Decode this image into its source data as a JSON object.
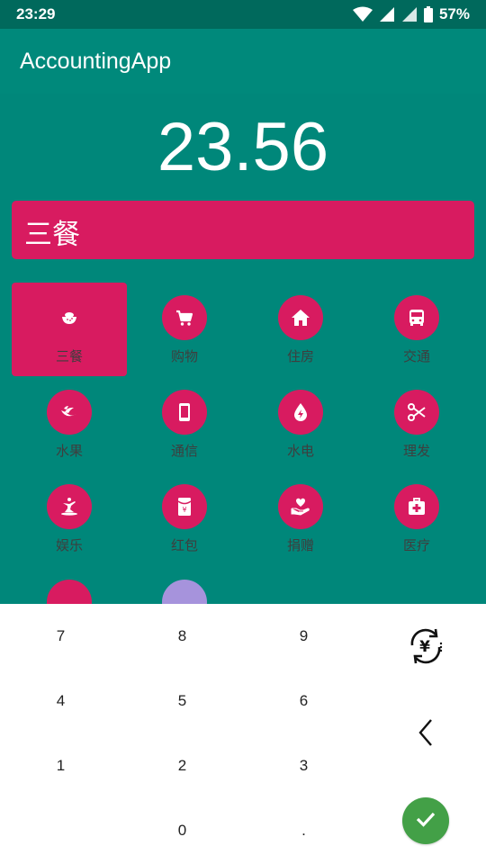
{
  "status_bar": {
    "time": "23:29",
    "battery": "57%"
  },
  "app_bar": {
    "title": "AccountingApp"
  },
  "amount": "23.56",
  "selected_category": "三餐",
  "categories": [
    {
      "label": "三餐",
      "icon": "rice-bowl-icon",
      "selected": true
    },
    {
      "label": "购物",
      "icon": "shopping-cart-icon",
      "selected": false
    },
    {
      "label": "住房",
      "icon": "home-icon",
      "selected": false
    },
    {
      "label": "交通",
      "icon": "bus-icon",
      "selected": false
    },
    {
      "label": "水果",
      "icon": "fruit-icon",
      "selected": false
    },
    {
      "label": "通信",
      "icon": "phone-icon",
      "selected": false
    },
    {
      "label": "水电",
      "icon": "water-electric-icon",
      "selected": false
    },
    {
      "label": "理发",
      "icon": "scissors-icon",
      "selected": false
    },
    {
      "label": "娱乐",
      "icon": "entertainment-icon",
      "selected": false
    },
    {
      "label": "红包",
      "icon": "red-packet-icon",
      "selected": false
    },
    {
      "label": "捐赠",
      "icon": "donation-icon",
      "selected": false
    },
    {
      "label": "医疗",
      "icon": "medical-kit-icon",
      "selected": false
    }
  ],
  "keypad": {
    "keys": [
      "7",
      "8",
      "9",
      "4",
      "5",
      "6",
      "1",
      "2",
      "3",
      "",
      "0",
      "."
    ],
    "currency_switch_icon": "currency-switch-icon",
    "backspace_icon": "backspace-chevron-icon",
    "confirm_icon": "checkmark-icon"
  },
  "colors": {
    "status_bar": "#00695c",
    "app_bar": "#00897b",
    "background": "#00877a",
    "accent": "#d81b60",
    "confirm": "#43a047",
    "peek_secondary": "#a693dc"
  }
}
